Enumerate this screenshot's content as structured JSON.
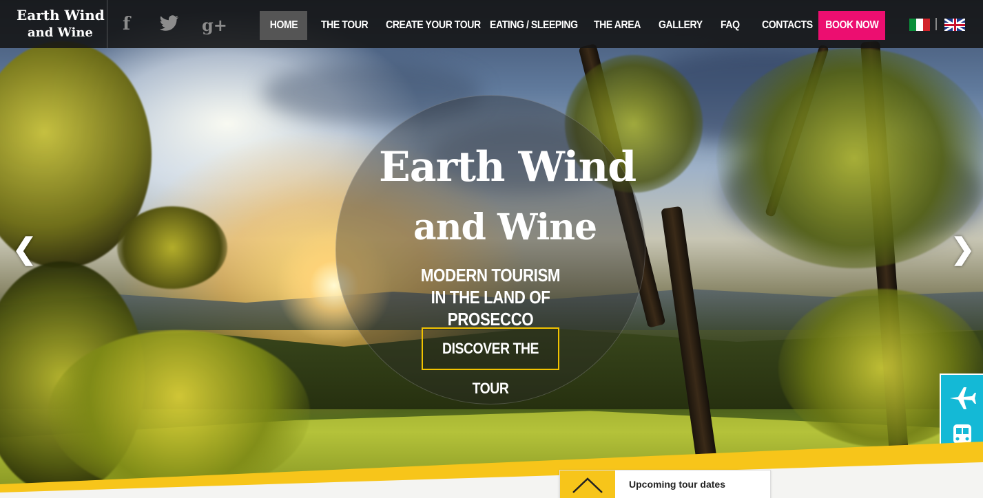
{
  "brand": {
    "logo_line1": "Earth Wind",
    "logo_line2": "and Wine"
  },
  "social": {
    "facebook": "f",
    "twitter": "t",
    "googleplus": "g+"
  },
  "nav": {
    "items": [
      {
        "label": "HOME",
        "active": true
      },
      {
        "label": "THE TOUR"
      },
      {
        "label": "CREATE YOUR TOUR"
      },
      {
        "label": "EATING / SLEEPING"
      },
      {
        "label": "THE AREA"
      },
      {
        "label": "GALLERY"
      },
      {
        "label": "FAQ"
      },
      {
        "label": "CONTACTS"
      }
    ],
    "book_label": "BOOK NOW"
  },
  "languages": {
    "it_icon": "italy-flag-icon",
    "en_icon": "uk-flag-icon"
  },
  "hero": {
    "title_line1": "Earth Wind",
    "title_line2": "and Wine",
    "subtitle_line1": "MODERN TOURISM",
    "subtitle_line2": "IN THE LAND OF PROSECCO",
    "cta_label": "DISCOVER THE TOUR",
    "prev_arrow": "❮",
    "next_arrow": "❯"
  },
  "transport": {
    "plane_icon": "airplane-icon",
    "train_icon": "train-icon"
  },
  "upcoming": {
    "label": "Upcoming tour dates",
    "toggle_icon": "chevron-up-icon"
  },
  "colors": {
    "nav_bg": "#141414",
    "book_now": "#ec0e70",
    "cta_border": "#f2c300",
    "accent_yellow": "#f7c51a",
    "transport_bg": "#14b9d6"
  }
}
